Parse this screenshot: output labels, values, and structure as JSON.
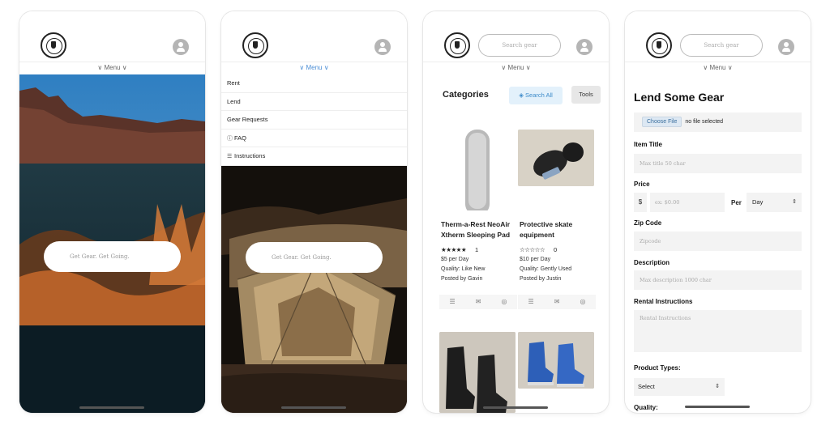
{
  "common": {
    "menu_label": "∨ Menu ∨",
    "search_placeholder": "Search gear",
    "tagline": "Get Gear. Get Going."
  },
  "menu": {
    "items": [
      {
        "label": "Rent",
        "icon": ""
      },
      {
        "label": "Lend",
        "icon": ""
      },
      {
        "label": "Gear Requests",
        "icon": ""
      },
      {
        "label": "FAQ",
        "icon": "ⓘ"
      },
      {
        "label": "Instructions",
        "icon": "☰"
      }
    ]
  },
  "browse": {
    "title": "Categories",
    "search_all": "◈ Search All",
    "tools": "Tools",
    "items": [
      {
        "title": "Therm-a-Rest NeoAir Xtherm Sleeping Pad",
        "stars": "★★★★★",
        "rating_count": "1",
        "price": "$5 per Day",
        "quality": "Quality: Like New",
        "posted_by": "Posted by Gavin"
      },
      {
        "title": "Protective skate equipment",
        "stars": "☆☆☆☆☆",
        "rating_count": "0",
        "price": "$10 per Day",
        "quality": "Quality: Gently Used",
        "posted_by": "Posted by Justin"
      }
    ],
    "action_icons": [
      "☰",
      "✉",
      "◎"
    ]
  },
  "lend": {
    "title": "Lend Some Gear",
    "choose_file": "Choose File",
    "no_file": "no file selected",
    "item_title_label": "Item Title",
    "item_title_placeholder": "Max title 50 char",
    "price_label": "Price",
    "currency": "$",
    "price_placeholder": "ex: $0.00",
    "per_label": "Per",
    "per_value": "Day",
    "zip_label": "Zip Code",
    "zip_placeholder": "Zipcode",
    "description_label": "Description",
    "description_placeholder": "Max description 1000 char",
    "rental_label": "Rental Instructions",
    "rental_placeholder": "Rental Instructions",
    "product_types_label": "Product Types:",
    "product_types_value": "Select",
    "quality_label": "Quality:"
  },
  "colors": {
    "accent_blue": "#4d8fd6",
    "search_all_bg": "#e3f1fb"
  }
}
